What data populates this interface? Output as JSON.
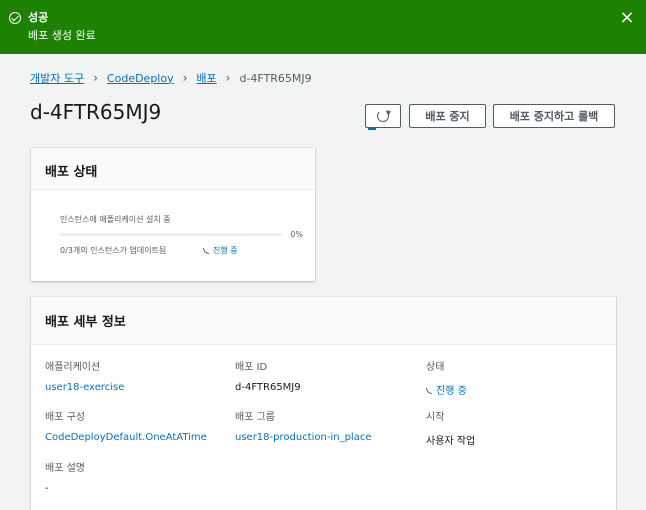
{
  "flash": {
    "title": "성공",
    "message": "배포 생성 완료",
    "close": "×",
    "color": "#1d8102"
  },
  "breadcrumb": {
    "items": [
      "개발자 도구",
      "CodeDeploy",
      "배포"
    ],
    "current": "d-4FTR65MJ9",
    "separator": "›"
  },
  "header": {
    "title": "d-4FTR65MJ9",
    "buttons": {
      "refresh": "refresh-icon",
      "stop": "배포 중지",
      "stop_rollback": "배포 중지하고 롤백"
    }
  },
  "status_panel": {
    "title": "배포 상태",
    "progress_label": "인스턴스에 애플리케이션 설치 중",
    "progress_percent": 0,
    "progress_text": "0%",
    "detail": "0/3개의 인스턴스가 업데이트됨",
    "status": "진행 중"
  },
  "details_panel": {
    "title": "배포 세부 정보",
    "fields": {
      "application": {
        "label": "애플리케이션",
        "value": "user18-exercise"
      },
      "deployment_id": {
        "label": "배포 ID",
        "value": "d-4FTR65MJ9"
      },
      "status": {
        "label": "상태",
        "value": "진행 중"
      },
      "config": {
        "label": "배포 구성",
        "value": "CodeDeployDefault.OneAtATime"
      },
      "group": {
        "label": "배포 그룹",
        "value": "user18-production-in_place"
      },
      "start": {
        "label": "시작",
        "value": "사용자 작업"
      },
      "description": {
        "label": "배포 설명",
        "value": "-"
      }
    }
  },
  "colors": {
    "link": "#0073bb",
    "text": "#16191f",
    "muted": "#545b64",
    "background": "#f2f3f3"
  }
}
